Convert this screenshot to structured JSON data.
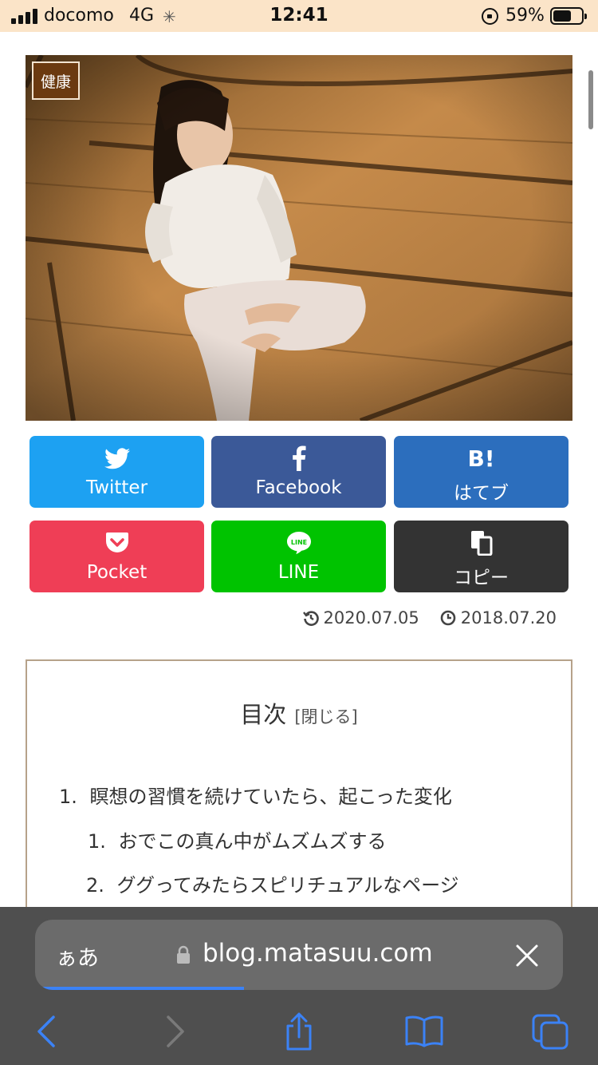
{
  "status_bar": {
    "carrier": "docomo",
    "network": "4G",
    "time": "12:41",
    "battery_percent": "59%"
  },
  "hero": {
    "category_badge": "健康"
  },
  "share_buttons": [
    {
      "label": "Twitter",
      "icon": "twitter-bird-icon",
      "color": "#1da1f2"
    },
    {
      "label": "Facebook",
      "icon": "facebook-f-icon",
      "color": "#3b5998"
    },
    {
      "label": "はてブ",
      "icon": "hatena-bookmark-icon",
      "color": "#2c6ebd"
    },
    {
      "label": "Pocket",
      "icon": "pocket-icon",
      "color": "#ef3e56"
    },
    {
      "label": "LINE",
      "icon": "line-icon",
      "color": "#00c300"
    },
    {
      "label": "コピー",
      "icon": "copy-icon",
      "color": "#333333"
    }
  ],
  "dates": {
    "updated": "2020.07.05",
    "published": "2018.07.20"
  },
  "toc": {
    "title": "目次",
    "toggle": "[閉じる]",
    "items": [
      {
        "num": "1.",
        "text": "瞑想の習慣を続けていたら、起こった変化"
      },
      {
        "num": "1.",
        "text": "おでこの真ん中がムズムズする"
      },
      {
        "num": "2.",
        "text": "ググってみたらスピリチュアルなページ"
      }
    ]
  },
  "safari": {
    "aa_label": "ぁあ",
    "url": "blog.matasuu.com",
    "accent_color": "#3b82f6"
  }
}
